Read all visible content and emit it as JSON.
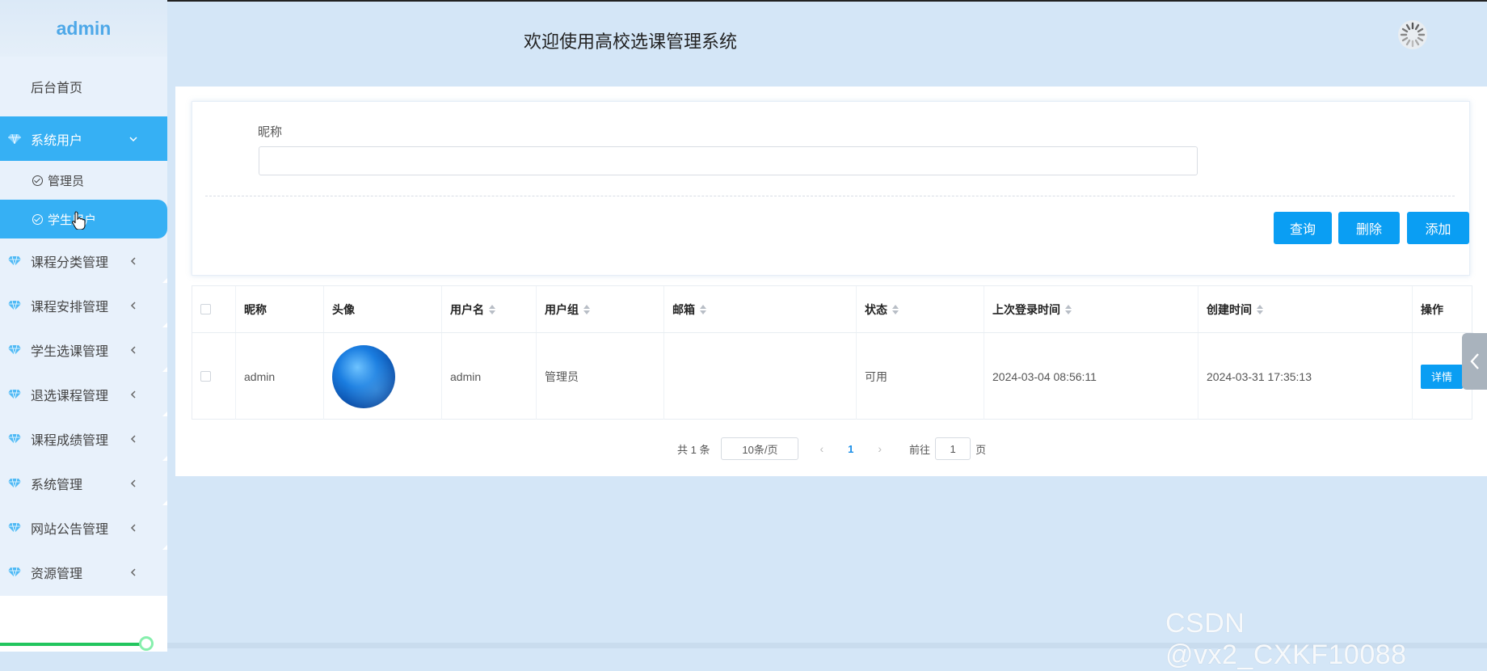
{
  "sidebar": {
    "brand": "admin",
    "home": "后台首页",
    "system_users": {
      "label": "系统用户",
      "children": [
        {
          "label": "管理员"
        },
        {
          "label": "学生用户"
        }
      ]
    },
    "menu": [
      {
        "label": "课程分类管理"
      },
      {
        "label": "课程安排管理"
      },
      {
        "label": "学生选课管理"
      },
      {
        "label": "退选课程管理"
      },
      {
        "label": "课程成绩管理"
      },
      {
        "label": "系统管理"
      },
      {
        "label": "网站公告管理"
      },
      {
        "label": "资源管理"
      }
    ]
  },
  "header": {
    "title": "欢迎使用高校选课管理系统"
  },
  "search": {
    "nickname_label": "昵称",
    "nickname_value": "",
    "query_btn": "查询",
    "delete_btn": "删除",
    "add_btn": "添加"
  },
  "table": {
    "columns": [
      "昵称",
      "头像",
      "用户名",
      "用户组",
      "邮箱",
      "状态",
      "上次登录时间",
      "创建时间",
      "操作"
    ],
    "rows": [
      {
        "nickname": "admin",
        "username": "admin",
        "group": "管理员",
        "email": "",
        "status": "可用",
        "last_login": "2024-03-04 08:56:11",
        "created": "2024-03-31 17:35:13",
        "action": "详情"
      }
    ]
  },
  "pagination": {
    "total": "共 1 条",
    "page_size": "10条/页",
    "current_page": "1",
    "goto_label": "前往",
    "goto_value": "1",
    "goto_unit": "页"
  },
  "watermark": "CSDN @vx2_CXKF10088",
  "colors": {
    "primary": "#0a9ef3",
    "active_nav": "#36b0f4",
    "background": "#d4e6f7"
  }
}
